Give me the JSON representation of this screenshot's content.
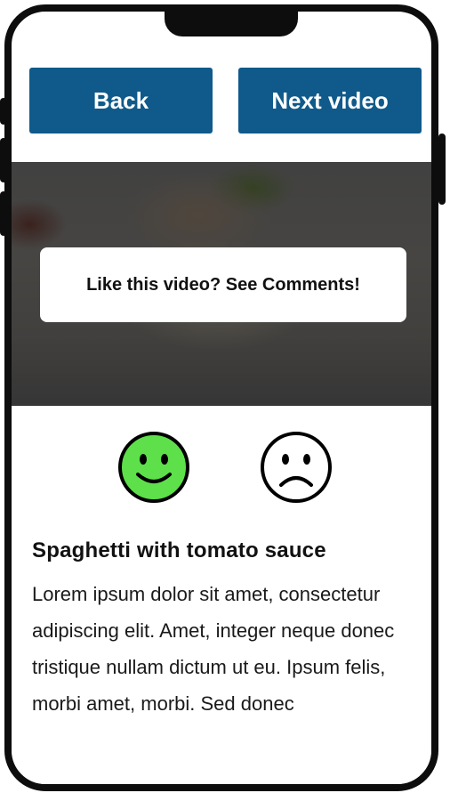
{
  "nav": {
    "back_label": "Back",
    "next_label": "Next video"
  },
  "video": {
    "banner_text": "Like this video? See Comments!"
  },
  "reactions": {
    "like_icon": "smiley-face-icon",
    "dislike_icon": "sad-face-icon",
    "like_color": "#5de04a"
  },
  "recipe": {
    "title": "Spaghetti with tomato sauce",
    "description": "Lorem ipsum dolor sit amet, consectetur adipiscing elit. Amet, integer neque donec tristique nullam dictum ut eu. Ipsum felis, morbi amet, morbi. Sed donec"
  },
  "colors": {
    "primary": "#0f5a8a",
    "frame": "#0d0d0d"
  }
}
